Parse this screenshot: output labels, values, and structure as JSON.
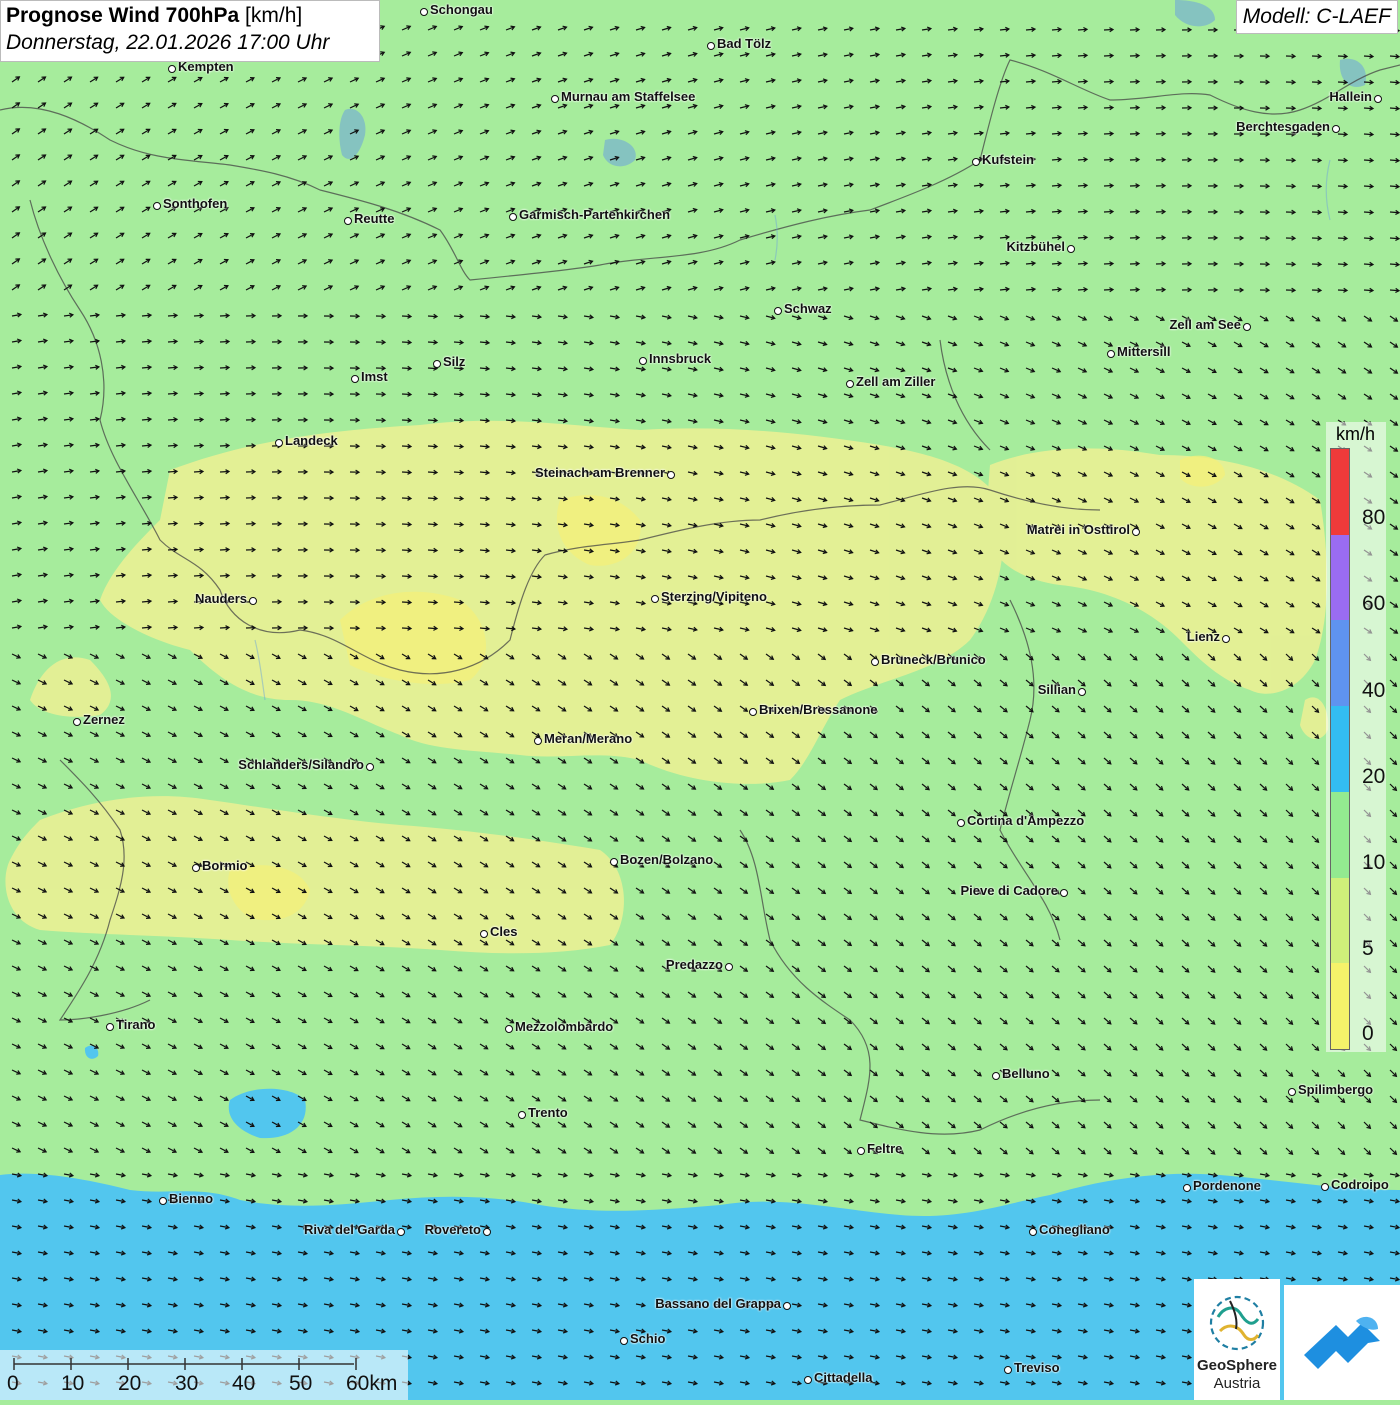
{
  "header": {
    "title_bold": "Prognose Wind 700hPa",
    "title_unit": "[km/h]",
    "datetime": "Donnerstag, 22.01.2026 17:00 Uhr"
  },
  "model": "Modell: C-LAEF",
  "legend": {
    "unit": "km/h",
    "ticks": [
      "80",
      "60",
      "40",
      "20",
      "10",
      "5",
      "0"
    ],
    "colors": [
      "#ef3a3a",
      "#9a6cf2",
      "#5f93f0",
      "#33bdf2",
      "#93ea90",
      "#cff07a",
      "#f5f36a"
    ]
  },
  "scale": {
    "labels": [
      "0",
      "10",
      "20",
      "30",
      "40",
      "50",
      "60km"
    ]
  },
  "logo": {
    "name": "GeoSphere",
    "sub": "Austria"
  },
  "colors": {
    "background_green": "#a6ec9c",
    "yellow_zone": "#e6f095",
    "blue_zone": "#52c6ee"
  },
  "cities": [
    {
      "name": "Schongau"
    },
    {
      "name": "Bad Tölz"
    },
    {
      "name": "Kempten"
    },
    {
      "name": "Murnau am Staffelsee"
    },
    {
      "name": "Hallein"
    },
    {
      "name": "Berchtesgaden"
    },
    {
      "name": "Kufstein"
    },
    {
      "name": "Sonthofen"
    },
    {
      "name": "Reutte"
    },
    {
      "name": "Garmisch-Partenkirchen"
    },
    {
      "name": "Kitzbühel"
    },
    {
      "name": "Schwaz"
    },
    {
      "name": "Zell am See"
    },
    {
      "name": "Innsbruck"
    },
    {
      "name": "Silz"
    },
    {
      "name": "Imst"
    },
    {
      "name": "Mittersill"
    },
    {
      "name": "Zell am Ziller"
    },
    {
      "name": "Landeck"
    },
    {
      "name": "Steinach am Brenner"
    },
    {
      "name": "Matrei in Osttirol"
    },
    {
      "name": "Nauders"
    },
    {
      "name": "Sterzing/Vipiteno"
    },
    {
      "name": "Lienz"
    },
    {
      "name": "Bruneck/Brunico"
    },
    {
      "name": "Sillian"
    },
    {
      "name": "Brixen/Bressanone"
    },
    {
      "name": "Zernez"
    },
    {
      "name": "Meran/Merano"
    },
    {
      "name": "Schlanders/Silandro"
    },
    {
      "name": "Cortina d'Ampezzo"
    },
    {
      "name": "Bozen/Bolzano"
    },
    {
      "name": "Bormio"
    },
    {
      "name": "Pieve di Cadore"
    },
    {
      "name": "Cles"
    },
    {
      "name": "Predazzo"
    },
    {
      "name": "Tirano"
    },
    {
      "name": "Mezzolombardo"
    },
    {
      "name": "Belluno"
    },
    {
      "name": "Spilimbergo"
    },
    {
      "name": "Trento"
    },
    {
      "name": "Feltre"
    },
    {
      "name": "Pordenone"
    },
    {
      "name": "Codroipo"
    },
    {
      "name": "Bienno"
    },
    {
      "name": "Riva del Garda"
    },
    {
      "name": "Rovereto"
    },
    {
      "name": "Conegliano"
    },
    {
      "name": "Bassano del Grappa"
    },
    {
      "name": "Schio"
    },
    {
      "name": "Treviso"
    },
    {
      "name": "Cittadella"
    }
  ]
}
